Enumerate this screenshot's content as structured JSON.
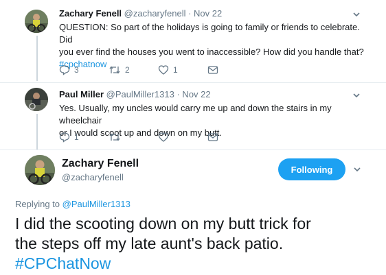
{
  "tweets": [
    {
      "name": "Zachary Fenell",
      "handle": "@zacharyfenell",
      "time": "· Nov 22",
      "text_line1": "QUESTION: So part of the holidays is going to family or friends to celebrate. Did",
      "text_line2": "you ever find the houses you went to inaccessible? How did you handle that?",
      "hashtag": "#cpchatnow",
      "replies": "3",
      "retweets": "2",
      "likes": "1"
    },
    {
      "name": "Paul Miller",
      "handle": "@PaulMiller1313",
      "time": "· Nov 22",
      "text_line1": "Yes. Usually, my uncles would carry me up and down the stairs in my wheelchair",
      "text_line2": "or I would scoot up and down on my butt.",
      "replies": "1",
      "retweets": "",
      "likes": ""
    }
  ],
  "main_tweet": {
    "name": "Zachary Fenell",
    "handle": "@zacharyfenell",
    "follow_label": "Following",
    "replying_prefix": "Replying to",
    "replying_to": "@PaulMiller1313",
    "text_line1": "I did the scooting down on my butt trick for",
    "text_line2": "the steps off my late aunt's back patio.",
    "hashtag": "#CPChatNow"
  },
  "icons": [
    "reply-icon",
    "retweet-icon",
    "like-icon",
    "direct-message-icon",
    "chevron-down-icon"
  ],
  "colors": {
    "accent": "#1da1f2",
    "hashtag": "#1b95e0",
    "muted": "#657786"
  }
}
